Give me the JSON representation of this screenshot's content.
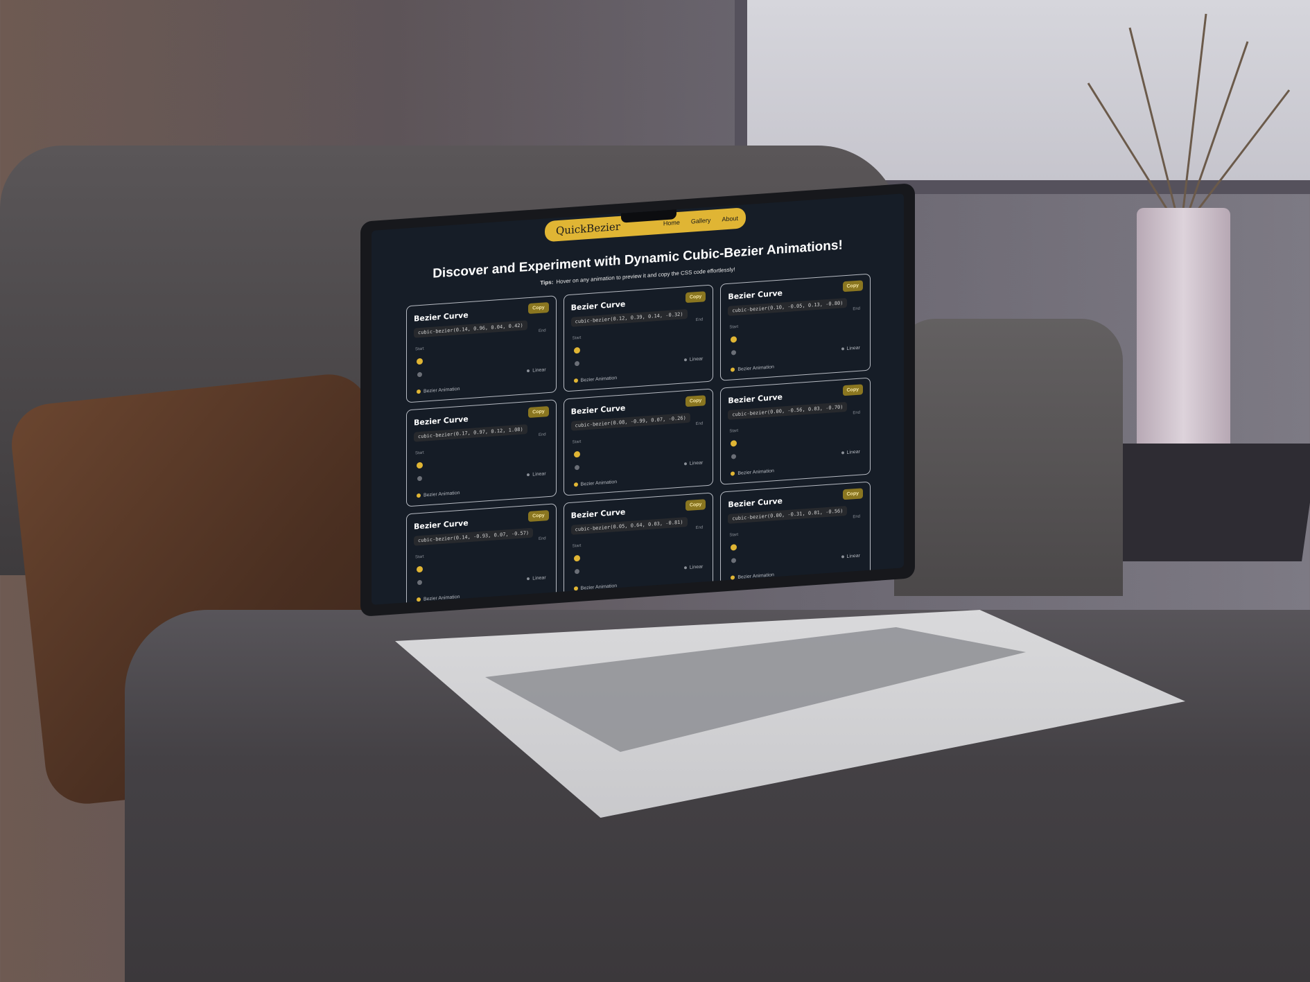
{
  "colors": {
    "accent": "#e0b534",
    "background": "#161d27",
    "card_border": "#b8bcc4",
    "copy_button": "#8a7620",
    "linear_dot": "#6b6f77"
  },
  "navbar": {
    "brand": "QuickBezier",
    "links": [
      "Home",
      "Gallery",
      "About"
    ]
  },
  "hero": {
    "headline": "Discover and Experiment with Dynamic Cubic-Bezier Animations!",
    "tips_label": "Tips:",
    "tips_text": "Hover on any animation to preview it and copy the CSS code effortlessly!"
  },
  "cards": [
    {
      "title": "Bezier Curve",
      "copy": "Copy",
      "code": "cubic-bezier(0.14, 0.96, 0.04, 0.42)",
      "start": "Start",
      "end": "End",
      "linear": "Linear",
      "bezier": "Bezier Animation"
    },
    {
      "title": "Bezier Curve",
      "copy": "Copy",
      "code": "cubic-bezier(0.12, 0.39, 0.14, -0.32)",
      "start": "Start",
      "end": "End",
      "linear": "Linear",
      "bezier": "Bezier Animation"
    },
    {
      "title": "Bezier Curve",
      "copy": "Copy",
      "code": "cubic-bezier(0.10, -0.05, 0.13, -0.80)",
      "start": "Start",
      "end": "End",
      "linear": "Linear",
      "bezier": "Bezier Animation"
    },
    {
      "title": "Bezier Curve",
      "copy": "Copy",
      "code": "cubic-bezier(0.17, 0.97, 0.12, 1.08)",
      "start": "Start",
      "end": "End",
      "linear": "Linear",
      "bezier": "Bezier Animation"
    },
    {
      "title": "Bezier Curve",
      "copy": "Copy",
      "code": "cubic-bezier(0.08, -0.99, 0.07, -0.26)",
      "start": "Start",
      "end": "End",
      "linear": "Linear",
      "bezier": "Bezier Animation"
    },
    {
      "title": "Bezier Curve",
      "copy": "Copy",
      "code": "cubic-bezier(0.00, -0.56, 0.03, -0.70)",
      "start": "Start",
      "end": "End",
      "linear": "Linear",
      "bezier": "Bezier Animation"
    },
    {
      "title": "Bezier Curve",
      "copy": "Copy",
      "code": "cubic-bezier(0.14, -0.93, 0.07, -0.57)",
      "start": "Start",
      "end": "End",
      "linear": "Linear",
      "bezier": "Bezier Animation"
    },
    {
      "title": "Bezier Curve",
      "copy": "Copy",
      "code": "cubic-bezier(0.05, 0.64, 0.03, -0.81)",
      "start": "Start",
      "end": "End",
      "linear": "Linear",
      "bezier": "Bezier Animation"
    },
    {
      "title": "Bezier Curve",
      "copy": "Copy",
      "code": "cubic-bezier(0.00, -0.31, 0.01, -0.56)",
      "start": "Start",
      "end": "End",
      "linear": "Linear",
      "bezier": "Bezier Animation"
    }
  ]
}
